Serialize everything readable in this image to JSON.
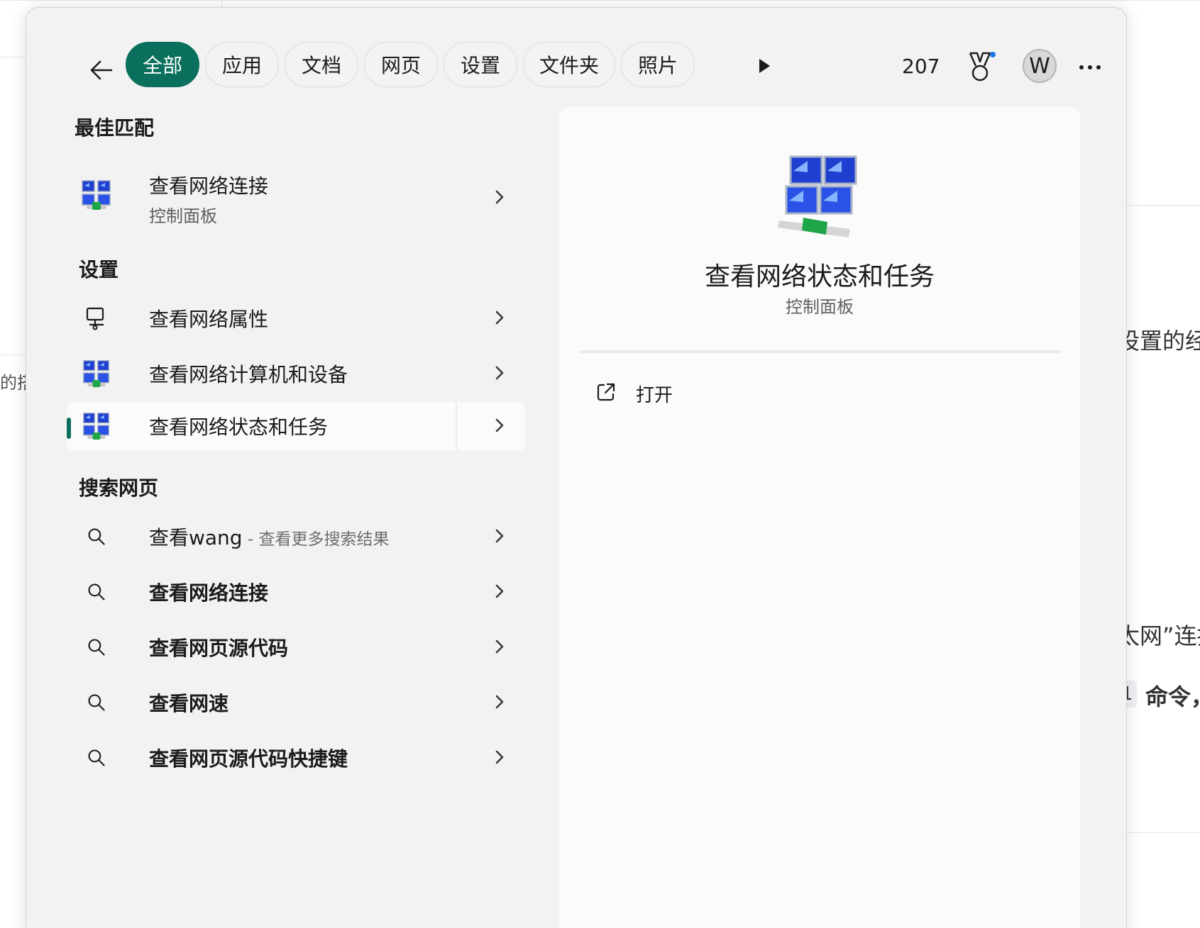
{
  "background_doc": {
    "fragments": [
      "的搭",
      "设置的经",
      "太网”连接",
      "命令，"
    ],
    "code_fragment": "1"
  },
  "topbar": {
    "back_label": "返回",
    "filters": [
      "全部",
      "应用",
      "文档",
      "网页",
      "设置",
      "文件夹",
      "照片"
    ],
    "active_filter": "全部",
    "points": "207",
    "avatar_initial": "W"
  },
  "results": {
    "best_match": {
      "title": "最佳匹配",
      "item": {
        "label": "查看网络连接",
        "sublabel": "控制面板"
      }
    },
    "settings": {
      "title": "设置",
      "items": [
        {
          "label": "查看网络属性"
        },
        {
          "label": "查看网络计算机和设备"
        },
        {
          "label": "查看网络状态和任务",
          "selected": true
        }
      ]
    },
    "web": {
      "title": "搜索网页",
      "items": [
        {
          "label": "查看wang",
          "hint": " - 查看更多搜索结果"
        },
        {
          "label": "查看网络连接"
        },
        {
          "label": "查看网页源代码"
        },
        {
          "label": "查看网速"
        },
        {
          "label": "查看网页源代码快捷键"
        }
      ]
    }
  },
  "detail": {
    "title": "查看网络状态和任务",
    "subtitle": "控制面板",
    "actions": [
      {
        "label": "打开",
        "icon": "open-external-icon"
      }
    ]
  },
  "icons": {
    "back": "arrow-left-icon",
    "play": "play-icon",
    "rewards": "medal-icon",
    "more": "ellipsis-icon",
    "network_control": "network-computers-icon",
    "network_properties": "monitor-network-icon",
    "search": "search-icon",
    "chevron": "chevron-right-icon"
  },
  "colors": {
    "accent": "#0a6f5c",
    "flyout_bg": "#f2f2f2",
    "detail_bg": "#fbfbfb",
    "notification_dot": "#1a73e8"
  }
}
